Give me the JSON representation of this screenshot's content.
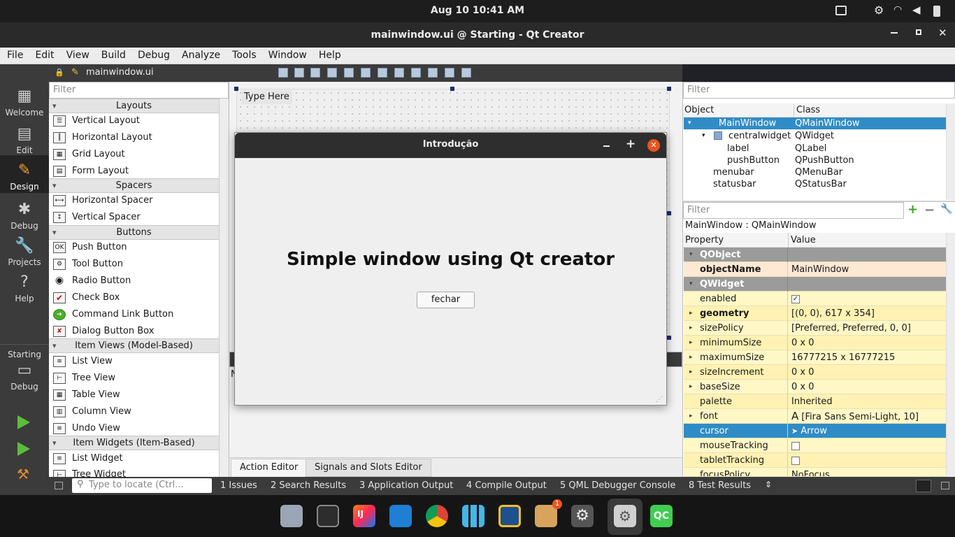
{
  "system": {
    "clock": "Aug 10  10:41 AM"
  },
  "window": {
    "title": "mainwindow.ui @ Starting - Qt Creator"
  },
  "menu": [
    "File",
    "Edit",
    "View",
    "Build",
    "Debug",
    "Analyze",
    "Tools",
    "Window",
    "Help"
  ],
  "modes": {
    "welcome": "Welcome",
    "edit": "Edit",
    "design": "Design",
    "debug": "Debug",
    "projects": "Projects",
    "help": "Help",
    "kit": "Starting",
    "kit_mode": "Debug"
  },
  "editor": {
    "file": "mainwindow.ui"
  },
  "widgetbox": {
    "filter_placeholder": "Filter",
    "cat_layouts": "Layouts",
    "layouts": [
      "Vertical Layout",
      "Horizontal Layout",
      "Grid Layout",
      "Form Layout"
    ],
    "cat_spacers": "Spacers",
    "spacers": [
      "Horizontal Spacer",
      "Vertical Spacer"
    ],
    "cat_buttons": "Buttons",
    "buttons": [
      "Push Button",
      "Tool Button",
      "Radio Button",
      "Check Box",
      "Command Link Button",
      "Dialog Button Box"
    ],
    "cat_itemviews": "Item Views (Model-Based)",
    "itemviews": [
      "List View",
      "Tree View",
      "Table View",
      "Column View",
      "Undo View"
    ],
    "cat_itemwidgets": "Item Widgets (Item-Based)",
    "itemwidgets": [
      "List Widget",
      "Tree Widget"
    ]
  },
  "form": {
    "menu_placeholder": "Type Here"
  },
  "preview": {
    "title": "Introdução",
    "label": "Simple window using Qt creator",
    "button": "fechar"
  },
  "bottom_tabs": {
    "action": "Action Editor",
    "signals": "Signals and Slots Editor"
  },
  "inspector": {
    "filter_placeholder": "Filter",
    "col_object": "Object",
    "col_class": "Class",
    "rows": [
      {
        "object": "MainWindow",
        "class": "QMainWindow"
      },
      {
        "object": "centralwidget",
        "class": "QWidget"
      },
      {
        "object": "label",
        "class": "QLabel"
      },
      {
        "object": "pushButton",
        "class": "QPushButton"
      },
      {
        "object": "menubar",
        "class": "QMenuBar"
      },
      {
        "object": "statusbar",
        "class": "QStatusBar"
      }
    ]
  },
  "properties": {
    "filter_placeholder": "Filter",
    "context": "MainWindow : QMainWindow",
    "col_property": "Property",
    "col_value": "Value",
    "grp_qobject": "QObject",
    "objectName": "objectName",
    "objectName_val": "MainWindow",
    "grp_qwidget": "QWidget",
    "enabled": "enabled",
    "enabled_val": "✓",
    "geometry": "geometry",
    "geometry_val": "[(0, 0), 617 x 354]",
    "sizePolicy": "sizePolicy",
    "sizePolicy_val": "[Preferred, Preferred, 0, 0]",
    "minimumSize": "minimumSize",
    "minimumSize_val": "0 x 0",
    "maximumSize": "maximumSize",
    "maximumSize_val": "16777215 x 16777215",
    "sizeIncrement": "sizeIncrement",
    "sizeIncrement_val": "0 x 0",
    "baseSize": "baseSize",
    "baseSize_val": "0 x 0",
    "palette": "palette",
    "palette_val": "Inherited",
    "font": "font",
    "font_val": "[Fira Sans Semi-Light, 10]",
    "cursor": "cursor",
    "cursor_val": "Arrow",
    "mouseTracking": "mouseTracking",
    "tabletTracking": "tabletTracking",
    "focusPolicy": "focusPolicy",
    "focusPolicy_val": "NoFocus"
  },
  "status": {
    "locate_placeholder": "Type to locate (Ctrl...",
    "panes": [
      "1  Issues",
      "2  Search Results",
      "3  Application Output",
      "4  Compile Output",
      "5  QML Debugger Console",
      "8  Test Results"
    ]
  },
  "dock": {
    "badge": "1"
  },
  "colors": {
    "selection": "#308cc6",
    "prop_bg": "#fff7c6",
    "prop_bg_alt": "#fff2b3",
    "qc_green": "#41cd52",
    "close_orange": "#e95420"
  }
}
